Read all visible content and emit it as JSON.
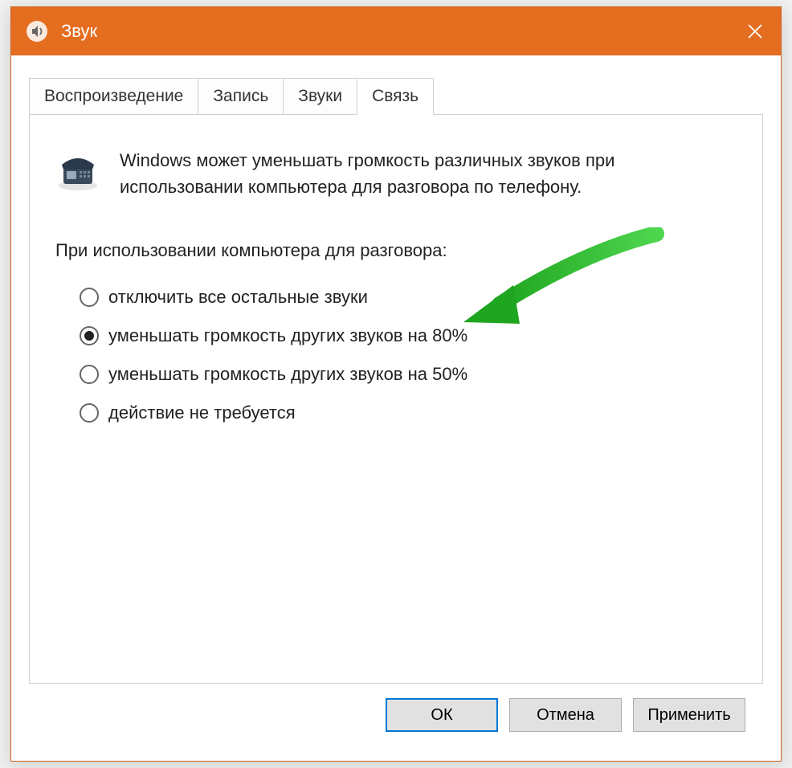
{
  "window": {
    "title": "Звук"
  },
  "tabs": [
    {
      "label": "Воспроизведение",
      "active": false
    },
    {
      "label": "Запись",
      "active": false
    },
    {
      "label": "Звуки",
      "active": false
    },
    {
      "label": "Связь",
      "active": true
    }
  ],
  "content": {
    "description": "Windows может уменьшать громкость различных звуков при использовании компьютера для разговора по телефону.",
    "section_label": "При использовании компьютера для разговора:",
    "options": [
      {
        "label": "отключить все остальные звуки",
        "selected": false
      },
      {
        "label": "уменьшать громкость других звуков на 80%",
        "selected": true
      },
      {
        "label": "уменьшать громкость других звуков на 50%",
        "selected": false
      },
      {
        "label": "действие не требуется",
        "selected": false
      }
    ]
  },
  "buttons": {
    "ok": "ОК",
    "cancel": "Отмена",
    "apply": "Применить"
  }
}
